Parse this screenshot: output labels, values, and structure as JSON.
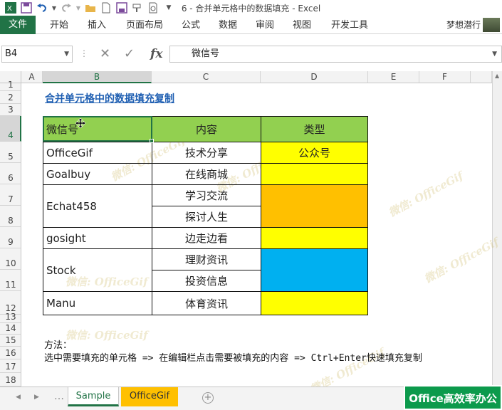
{
  "window": {
    "title": "6 - 合并单元格中的数据填充 - Excel"
  },
  "ribbon": {
    "tabs": [
      "文件",
      "开始",
      "插入",
      "页面布局",
      "公式",
      "数据",
      "审阅",
      "视图",
      "开发工具"
    ],
    "user": "梦想潜行"
  },
  "formula_bar": {
    "name_box": "B4",
    "content": "微信号"
  },
  "columns": [
    "A",
    "B",
    "C",
    "D",
    "E",
    "F"
  ],
  "rows": [
    "1",
    "2",
    "3",
    "4",
    "5",
    "6",
    "7",
    "8",
    "9",
    "10",
    "11",
    "12",
    "13",
    "14",
    "15",
    "16",
    "17",
    "18"
  ],
  "sheet": {
    "heading": "合并单元格中的数据填充复制",
    "table": {
      "headers": [
        "微信号",
        "内容",
        "类型"
      ],
      "col_b": [
        "OfficeGif",
        "Goalbuy",
        "Echat458",
        "gosight",
        "Stock",
        "Manu"
      ],
      "col_c": [
        "技术分享",
        "在线商城",
        "学习交流",
        "探讨人生",
        "边走边看",
        "理财资讯",
        "投资信息",
        "体育资讯"
      ],
      "col_d": [
        "公众号"
      ]
    },
    "note_title": "方法：",
    "note_text": "选中需要填充的单元格 => 在编辑栏点击需要被填充的内容 => Ctrl+Enter快速填充复制"
  },
  "watermark": "微信: OfficeGif",
  "sheet_tabs": [
    "Sample",
    "OfficeGif"
  ],
  "brand": "Office高效率办公",
  "colors": {
    "header_green": "#92d050",
    "yellow": "#ffff00",
    "orange": "#ffc000",
    "blue": "#00b0f0",
    "excel_green": "#217346"
  }
}
